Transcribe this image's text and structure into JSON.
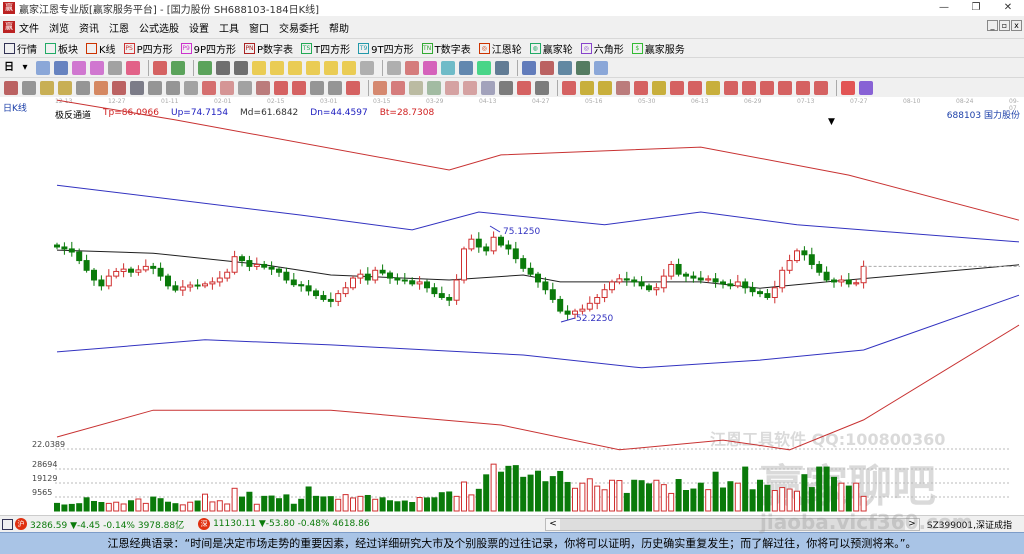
{
  "window": {
    "title": "赢家江恩专业版[赢家服务平台] - [国力股份  SH688103-184日K线]",
    "minimize": "—",
    "restore": "❐",
    "close": "✕"
  },
  "menu": [
    "文件",
    "浏览",
    "资讯",
    "江恩",
    "公式选股",
    "设置",
    "工具",
    "窗口",
    "交易委托",
    "帮助"
  ],
  "toolbar1": [
    {
      "icon": "quote-grid-icon",
      "label": "行情",
      "color": "#335"
    },
    {
      "icon": "sector-icon",
      "label": "板块",
      "color": "#2a6"
    },
    {
      "icon": "kline-icon",
      "label": "K线",
      "color": "#c30"
    },
    {
      "icon": "ps-icon",
      "badge": "PS",
      "label": "P四方形",
      "color": "#c33"
    },
    {
      "icon": "p9-icon",
      "badge": "P9",
      "label": "9P四方形",
      "color": "#c3c"
    },
    {
      "icon": "pn-icon",
      "badge": "PN",
      "label": "P数字表",
      "color": "#a22"
    },
    {
      "icon": "ts-icon",
      "badge": "TS",
      "label": "T四方形",
      "color": "#2a5"
    },
    {
      "icon": "t9-icon",
      "badge": "T9",
      "label": "9T四方形",
      "color": "#29a"
    },
    {
      "icon": "tn-icon",
      "badge": "TN",
      "label": "T数字表",
      "color": "#3a3"
    },
    {
      "icon": "gann-wheel-icon",
      "badge": "◎",
      "label": "江恩轮",
      "color": "#c30"
    },
    {
      "icon": "winner-wheel-icon",
      "badge": "◍",
      "label": "赢家轮",
      "color": "#2a6"
    },
    {
      "icon": "hexagon-icon",
      "badge": "◎",
      "label": "六角形",
      "color": "#84c"
    },
    {
      "icon": "dollar-icon",
      "badge": "$",
      "label": "赢家服务",
      "color": "#3b3"
    }
  ],
  "period_selector": "日",
  "axis_dates": [
    "12-13",
    "12-27",
    "01-11",
    "02-01",
    "02-15",
    "03-01",
    "03-15",
    "03-29",
    "04-13",
    "04-27",
    "05-16",
    "05-30",
    "06-13",
    "06-29",
    "07-13",
    "07-27",
    "08-10",
    "08-24",
    "09-07"
  ],
  "chart_header": {
    "period_label": "日K线",
    "indicator": "极反通道",
    "tp": "Tp=86.0966",
    "up": "Up=74.7154",
    "md": "Md=61.6842",
    "dn": "Dn=44.4597",
    "bt": "Bt=28.7308",
    "stock": "688103 国力股份"
  },
  "colors": {
    "up": "#d03030",
    "down": "#0a7a0a",
    "band_outer": "#c83232",
    "band_inner": "#3232c0",
    "mid": "#202020"
  },
  "chart_data": {
    "type": "candlestick",
    "title": "国力股份 688103 日K线 极反通道",
    "price_range": [
      17,
      110
    ],
    "closes": [
      70.5,
      70.0,
      69.2,
      67.0,
      64.5,
      62.0,
      60.5,
      63.0,
      64.2,
      64.8,
      64.0,
      64.6,
      65.5,
      65.0,
      63.0,
      60.5,
      59.4,
      60.2,
      60.7,
      60.5,
      61.0,
      61.5,
      62.5,
      64.0,
      68.0,
      67.0,
      65.5,
      66.0,
      65.3,
      64.8,
      64.0,
      62.0,
      60.8,
      60.5,
      59.2,
      58.0,
      57.0,
      56.5,
      58.5,
      60.0,
      62.5,
      63.5,
      62.0,
      64.5,
      63.8,
      62.5,
      62.0,
      61.8,
      61.0,
      61.5,
      60.0,
      58.5,
      57.5,
      56.8,
      62.0,
      70.0,
      72.5,
      70.5,
      69.5,
      73.0,
      71.0,
      70.0,
      67.5,
      65.0,
      63.5,
      61.5,
      59.5,
      57.0,
      54.0,
      53.2,
      54.0,
      54.5,
      56.0,
      57.5,
      59.5,
      61.5,
      62.3,
      62.0,
      61.5,
      60.5,
      59.5,
      60.0,
      63.0,
      66.0,
      63.5,
      63.0,
      62.5,
      62.0,
      62.3,
      61.5,
      61.0,
      60.5,
      61.5,
      60.0,
      59.0,
      58.5,
      57.5,
      60.0,
      64.5,
      67.0,
      69.5,
      68.5,
      66.0,
      64.0,
      62.0,
      61.5,
      62.0,
      61.0,
      61.3,
      65.5
    ],
    "volumes": [
      5200,
      4100,
      4500,
      5000,
      9000,
      6500,
      5800,
      5200,
      6000,
      4800,
      7000,
      8200,
      5200,
      9500,
      8400,
      6000,
      5000,
      4200,
      6000,
      6800,
      11500,
      6200,
      7000,
      4800,
      15500,
      9500,
      12800,
      4600,
      10000,
      10200,
      8400,
      11000,
      4600,
      8000,
      16400,
      10000,
      9600,
      9800,
      8000,
      11200,
      8900,
      10000,
      10600,
      8000,
      9000,
      7000,
      6300,
      6800,
      5800,
      9200,
      8900,
      9000,
      12500,
      13000,
      10000,
      19800,
      11000,
      14800,
      24700,
      32000,
      26500,
      30500,
      31000,
      23000,
      24500,
      27200,
      20000,
      23500,
      27000,
      19500,
      15500,
      19000,
      22000,
      17000,
      14500,
      21000,
      20800,
      12000,
      21000,
      20700,
      18500,
      21000,
      18000,
      12000,
      21500,
      14000,
      15000,
      19000,
      14600,
      26500,
      15700,
      20000,
      19000,
      30000,
      14500,
      21000,
      17500,
      14000,
      16000,
      15000,
      13500,
      24800,
      16000,
      30000,
      30000,
      23000,
      19000,
      17000,
      19000,
      10000,
      9000,
      22000,
      12000
    ],
    "annotations": {
      "high": "75.1250",
      "low": "52.2250"
    },
    "volume_ticks": [
      "22.0389",
      "28694",
      "19129",
      "9565"
    ],
    "bands": {
      "tp": [
        [
          0,
          108.3
        ],
        [
          16,
          103.2
        ],
        [
          53,
          90.3
        ],
        [
          60,
          94.2
        ],
        [
          87,
          96.2
        ],
        [
          107,
          89.0
        ],
        [
          130,
          77.4
        ]
      ],
      "up": [
        [
          0,
          86.4
        ],
        [
          33,
          78.7
        ],
        [
          48,
          74.9
        ],
        [
          57,
          79.5
        ],
        [
          74,
          76.2
        ],
        [
          87,
          79.5
        ],
        [
          100,
          76.2
        ],
        [
          130,
          71.8
        ]
      ],
      "md": [
        [
          0,
          69.7
        ],
        [
          13,
          68.9
        ],
        [
          28,
          65.9
        ],
        [
          37,
          63.3
        ],
        [
          53,
          62.0
        ],
        [
          63,
          63.3
        ],
        [
          68,
          61.5
        ],
        [
          87,
          61.5
        ],
        [
          95,
          59.9
        ],
        [
          104,
          61.5
        ],
        [
          130,
          65.9
        ]
      ],
      "dn": [
        [
          0,
          43.5
        ],
        [
          20,
          46.6
        ],
        [
          37,
          45.3
        ],
        [
          63,
          42.7
        ],
        [
          79,
          39.4
        ],
        [
          95,
          41.4
        ],
        [
          109,
          44.0
        ],
        [
          130,
          58.1
        ]
      ],
      "bt": [
        [
          0,
          21.6
        ],
        [
          13,
          28.5
        ],
        [
          37,
          28.5
        ],
        [
          60,
          24.7
        ],
        [
          76,
          18.3
        ],
        [
          90,
          20.8
        ],
        [
          99,
          18.3
        ],
        [
          109,
          26.0
        ],
        [
          130,
          50.4
        ]
      ]
    }
  },
  "watermark": {
    "line1": "江恩工具软件  QQ:100800360",
    "line2": "赢家聊吧",
    "line3": "jiaoba.vicf360.com"
  },
  "status": {
    "sh_badge": "沪",
    "sh_text": "3286.59 ▼-4.45 -0.14% 3978.88亿",
    "sz_badge": "深",
    "sz_text": "11130.11 ▼-53.80 -0.48% 4618.86",
    "scroll_left": "<",
    "scroll_right": ">",
    "index_name": "SZ399001,深证成指"
  },
  "quote": "江恩经典语录：“时间是决定市场走势的重要因素，经过详细研究大市及个别股票的过往记录，你将可以证明，历史确实重复发生；而了解过往，你将可以预测将来。”。"
}
